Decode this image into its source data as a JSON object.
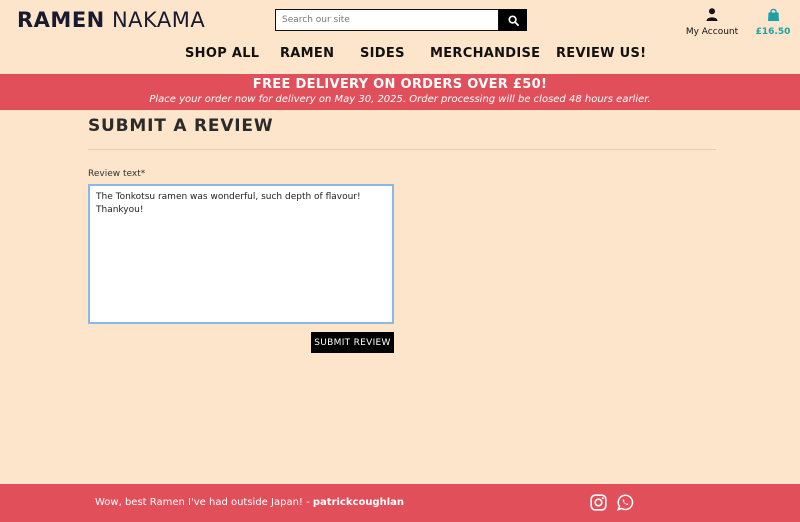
{
  "brand": {
    "bold": "RAMEN",
    "light": "NAKAMA"
  },
  "search": {
    "placeholder": "Search our site"
  },
  "account": {
    "label": "My Account"
  },
  "basket": {
    "total": "£16.50"
  },
  "nav": {
    "items": [
      "SHOP ALL",
      "RAMEN",
      "SIDES",
      "MERCHANDISE",
      "REVIEW US!"
    ]
  },
  "banner": {
    "title": "FREE DELIVERY ON ORDERS OVER £50!",
    "subtitle": "Place your order now for delivery on May 30, 2025. Order processing will be closed 48 hours earlier."
  },
  "review": {
    "title": "SUBMIT A REVIEW",
    "field_label": "Review text*",
    "text": "The Tonkotsu ramen was wonderful, such depth of flavour! Thankyou!",
    "submit_label": "SUBMIT REVIEW"
  },
  "footer": {
    "quote": "Wow, best Ramen I've had outside Japan! -",
    "author": "patrickcoughlan"
  },
  "icons": {
    "search": "search-icon",
    "account": "user-icon",
    "basket": "shopping-bag-icon",
    "instagram": "instagram-icon",
    "whatsapp": "whatsapp-icon"
  },
  "colors": {
    "background": "#fde5cb",
    "banner": "#e1505a",
    "accent": "#1ea0a8",
    "textarea_focus": "#8cb8e6"
  }
}
